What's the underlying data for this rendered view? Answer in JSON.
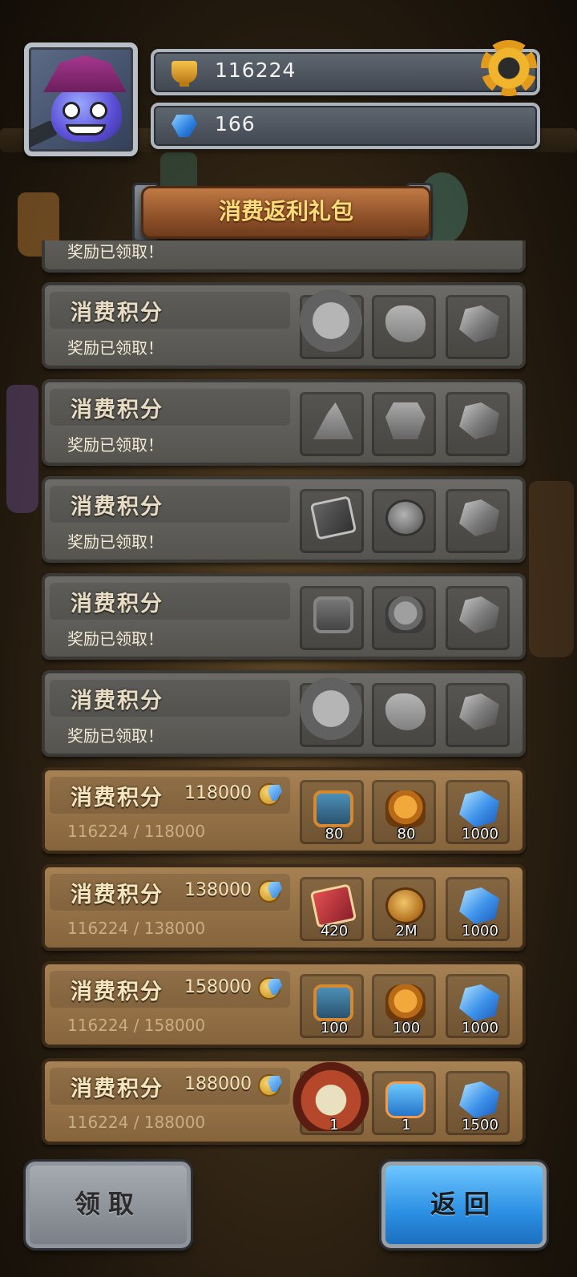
{
  "header": {
    "trophy_count": "116224",
    "gem_count": "166"
  },
  "title": "消费返利礼包",
  "partial_row_status": "奖励已领取！",
  "rows": [
    {
      "title": "消费积分",
      "status": "奖励已领取！",
      "state": "claimed",
      "rewards": [
        {
          "icon": "hero-portrait-icon"
        },
        {
          "icon": "stone-icon"
        },
        {
          "icon": "crystal-icon"
        }
      ]
    },
    {
      "title": "消费积分",
      "status": "奖励已领取！",
      "state": "claimed",
      "rewards": [
        {
          "icon": "hat-icon"
        },
        {
          "icon": "armor-icon"
        },
        {
          "icon": "crystal-icon"
        }
      ]
    },
    {
      "title": "消费积分",
      "status": "奖励已领取！",
      "state": "claimed",
      "rewards": [
        {
          "icon": "book-icon"
        },
        {
          "icon": "coin-icon"
        },
        {
          "icon": "crystal-icon"
        }
      ]
    },
    {
      "title": "消费积分",
      "status": "奖励已领取！",
      "state": "claimed",
      "rewards": [
        {
          "icon": "camera-icon"
        },
        {
          "icon": "backpack-icon"
        },
        {
          "icon": "crystal-icon"
        }
      ]
    },
    {
      "title": "消费积分",
      "status": "奖励已领取！",
      "state": "claimed",
      "rewards": [
        {
          "icon": "hero-portrait-icon"
        },
        {
          "icon": "stone-icon"
        },
        {
          "icon": "crystal-icon"
        }
      ]
    },
    {
      "title": "消费积分",
      "points": "118000",
      "progress": "116224 / 118000",
      "state": "active",
      "rewards": [
        {
          "icon": "camera-icon",
          "qty": "80"
        },
        {
          "icon": "backpack-icon",
          "qty": "80"
        },
        {
          "icon": "crystal-icon",
          "qty": "1000"
        }
      ]
    },
    {
      "title": "消费积分",
      "points": "138000",
      "progress": "116224 / 138000",
      "state": "active",
      "rewards": [
        {
          "icon": "book-icon",
          "qty": "420"
        },
        {
          "icon": "coin-icon",
          "qty": "2M"
        },
        {
          "icon": "crystal-icon",
          "qty": "1000"
        }
      ]
    },
    {
      "title": "消费积分",
      "points": "158000",
      "progress": "116224 / 158000",
      "state": "active",
      "rewards": [
        {
          "icon": "camera-icon",
          "qty": "100"
        },
        {
          "icon": "backpack-icon",
          "qty": "100"
        },
        {
          "icon": "crystal-icon",
          "qty": "1000"
        }
      ]
    },
    {
      "title": "消费积分",
      "points": "188000",
      "progress": "116224 / 188000",
      "state": "active",
      "rewards": [
        {
          "icon": "hero-portrait-icon",
          "qty": "1"
        },
        {
          "icon": "badge-icon",
          "qty": "1"
        },
        {
          "icon": "crystal-icon",
          "qty": "1500"
        }
      ]
    }
  ],
  "buttons": {
    "claim_label": "领取",
    "back_label": "返回"
  },
  "colors": {
    "claimed_row": "#6c6b67",
    "active_row": "#a68153",
    "title_gold": "#ffdc7a",
    "back_button": "#2b8fe3"
  }
}
